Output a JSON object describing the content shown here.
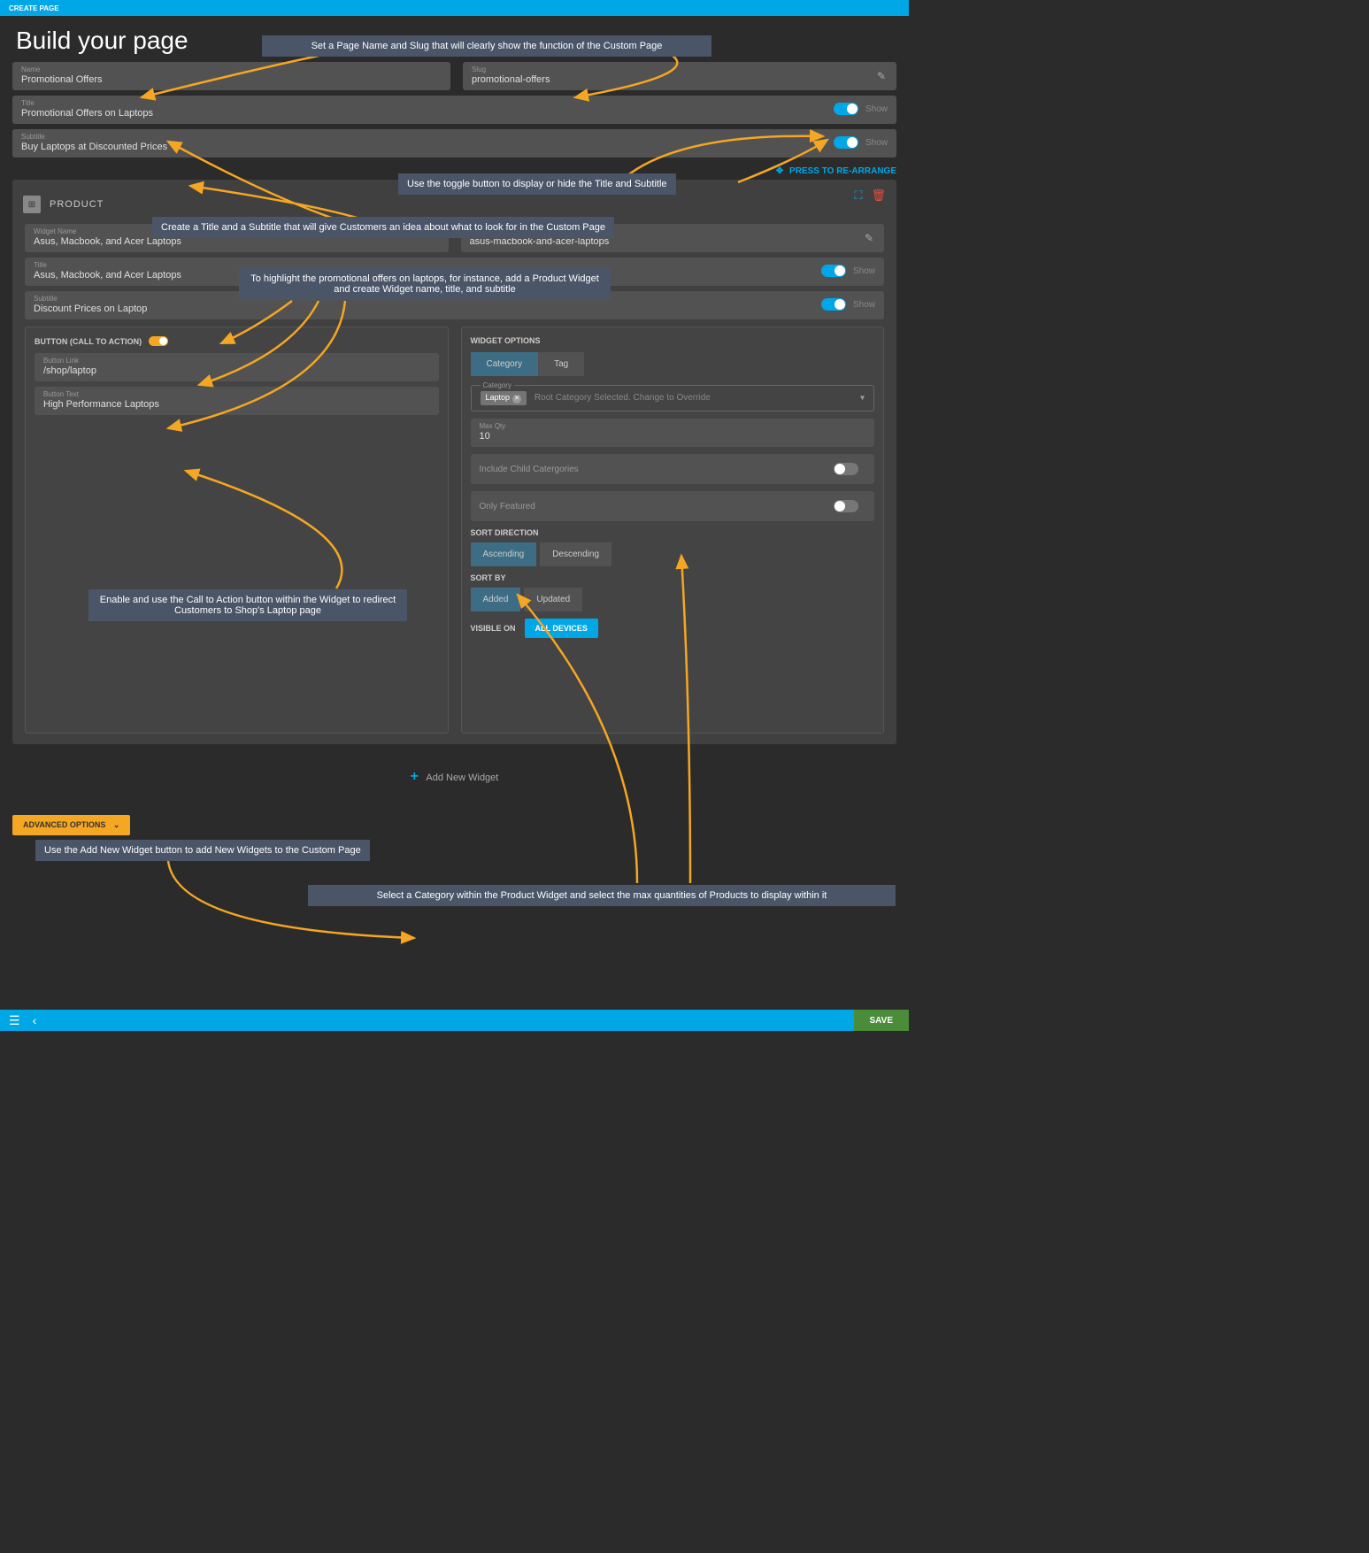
{
  "topBar": {
    "title": "CREATE PAGE"
  },
  "pageTitle": "Build your page",
  "form": {
    "name": {
      "label": "Name",
      "value": "Promotional Offers"
    },
    "slug": {
      "label": "Slug",
      "value": "promotional-offers"
    },
    "title": {
      "label": "Title",
      "value": "Promotional Offers on Laptops",
      "toggleLabel": "Show",
      "toggleOn": true
    },
    "subtitle": {
      "label": "Subtitle",
      "value": "Buy Laptops at Discounted Prices",
      "toggleLabel": "Show",
      "toggleOn": true
    }
  },
  "rearrange": {
    "label": "PRESS TO RE-ARRANGE"
  },
  "widget": {
    "type": "PRODUCT",
    "name": {
      "label": "Widget Name",
      "value": "Asus, Macbook, and Acer Laptops"
    },
    "slug": {
      "label": "Slug",
      "value": "asus-macbook-and-acer-laptops"
    },
    "title": {
      "label": "Title",
      "value": "Asus, Macbook, and Acer Laptops",
      "toggleLabel": "Show"
    },
    "subtitle": {
      "label": "Subtitle",
      "value": "Discount Prices on Laptop",
      "toggleLabel": "Show"
    },
    "cta": {
      "header": "BUTTON (CALL TO ACTION)",
      "link": {
        "label": "Button Link",
        "value": "/shop/laptop"
      },
      "text": {
        "label": "Button Text",
        "value": "High Performance Laptops"
      }
    },
    "options": {
      "header": "WIDGET OPTIONS",
      "tabs": [
        "Category",
        "Tag"
      ],
      "category": {
        "label": "Category",
        "chip": "Laptop",
        "placeholder": "Root Category Selected. Change to Override"
      },
      "maxQty": {
        "label": "Max Qty",
        "value": "10"
      },
      "includeChild": {
        "label": "Include Child Catergories"
      },
      "onlyFeatured": {
        "label": "Only Featured"
      },
      "sortDirHeader": "SORT DIRECTION",
      "sortDir": [
        "Ascending",
        "Descending"
      ],
      "sortByHeader": "SORT BY",
      "sortBy": [
        "Added",
        "Updated"
      ],
      "visibleLabel": "VISIBLE ON",
      "visibleValue": "ALL DEVICES"
    }
  },
  "addWidget": "Add New Widget",
  "advancedOptions": "ADVANCED OPTIONS",
  "save": "SAVE",
  "annotations": {
    "a1": "Set a Page Name and Slug that will clearly show the function of the Custom Page",
    "a2": "Use the toggle button to display or hide the Title and Subtitle",
    "a3": "Create a Title and a Subtitle that will give Customers an idea about what to look for in the Custom Page",
    "a4": "To highlight the promotional offers on laptops, for instance, add a Product Widget and create Widget name, title, and subtitle",
    "a5": "Enable and use the Call to Action button within the Widget to redirect Customers to Shop's Laptop page",
    "a6": "Use the Add New Widget button to add New Widgets to the Custom Page",
    "a7": "Select a Category within the Product Widget and select the max quantities of Products to display within it"
  }
}
